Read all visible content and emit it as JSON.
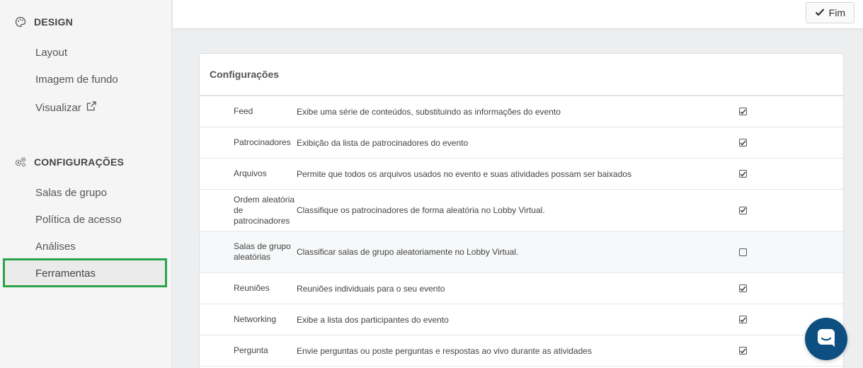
{
  "sidebar": {
    "design_heading": "DESIGN",
    "design_items": [
      {
        "label": "Layout"
      },
      {
        "label": "Imagem de fundo"
      },
      {
        "label": "Visualizar"
      }
    ],
    "config_heading": "CONFIGURAÇÕES",
    "config_items": [
      {
        "label": "Salas de grupo"
      },
      {
        "label": "Política de acesso"
      },
      {
        "label": "Análises"
      },
      {
        "label": "Ferramentas",
        "active": true
      }
    ]
  },
  "topbar": {
    "fim_label": "Fim"
  },
  "card": {
    "title": "Configurações",
    "rows": [
      {
        "name": "Feed",
        "description": "Exibe uma série de conteúdos, substituindo as informações do evento",
        "checked": true
      },
      {
        "name": "Patrocinadores",
        "description": "Exibição da lista de patrocinadores do evento",
        "checked": true
      },
      {
        "name": "Arquivos",
        "description": "Permite que todos os arquivos usados no evento e suas atividades possam ser baixados",
        "checked": true
      },
      {
        "name": "Ordem aleatória de patrocinadores",
        "description": "Classifique os patrocinadores de forma aleatória no Lobby Virtual.",
        "checked": true
      },
      {
        "name": "Salas de grupo aleatórias",
        "description": "Classificar salas de grupo aleatoriamente no Lobby Virtual.",
        "checked": false
      },
      {
        "name": "Reuniões",
        "description": "Reuniões individuais para o seu evento",
        "checked": true
      },
      {
        "name": "Networking",
        "description": "Exibe a lista dos participantes do evento",
        "checked": true
      },
      {
        "name": "Pergunta",
        "description": "Envie perguntas ou poste perguntas e respostas ao vivo durante as atividades",
        "checked": true
      }
    ]
  },
  "colors": {
    "accent_active": "#2aa44a",
    "chat": "#0d4f80"
  },
  "icons": {
    "design": "palette-icon",
    "config": "gears-icon",
    "external": "external-link-icon",
    "check": "check-icon",
    "chat": "chat-icon"
  }
}
